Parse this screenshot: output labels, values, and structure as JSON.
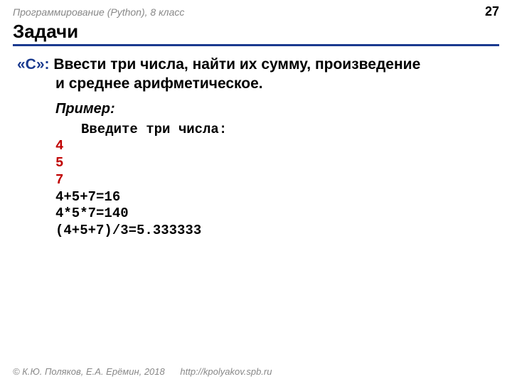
{
  "header": {
    "course": "Программирование (Python), 8 класс",
    "page": "27"
  },
  "title": "Задачи",
  "task": {
    "level": "«C»:",
    "line1": " Ввести три числа, найти их сумму, произведение",
    "line2": "и среднее арифметическое.",
    "example_label": "Пример:",
    "prompt": "Введите три числа:",
    "inputs": [
      "4",
      "5",
      "7"
    ],
    "outputs": [
      "4+5+7=16",
      "4*5*7=140",
      "(4+5+7)/3=5.333333"
    ]
  },
  "footer": {
    "copyright": "© К.Ю. Поляков, Е.А. Ерёмин, 2018",
    "url": "http://kpolyakov.spb.ru"
  }
}
